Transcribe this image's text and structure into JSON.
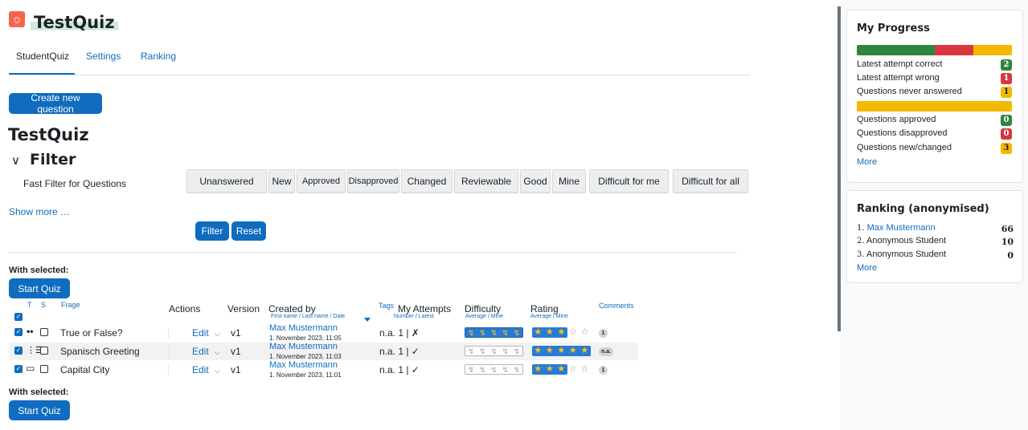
{
  "header": {
    "title": "TestQuiz"
  },
  "tabs": [
    {
      "label": "StudentQuiz"
    },
    {
      "label": "Settings"
    },
    {
      "label": "Ranking"
    }
  ],
  "create_button": "Create new question",
  "main_heading": "TestQuiz",
  "filter": {
    "heading": "Filter",
    "fast_filter_label": "Fast Filter for Questions",
    "buttons": [
      "Unanswered",
      "New",
      "Approved",
      "Disapproved",
      "Changed",
      "Reviewable",
      "Good",
      "Mine",
      "Difficult for me",
      "Difficult for all"
    ],
    "show_more": "Show more …",
    "filter_button": "Filter",
    "reset_button": "Reset"
  },
  "with_selected_label": "With selected:",
  "start_quiz_button": "Start Quiz",
  "table": {
    "headers": {
      "t": "T",
      "s": "S",
      "frage": "Frage",
      "actions": "Actions",
      "version": "Version",
      "created_by": "Created by",
      "created_by_sub": "First name / Last name / Date",
      "tags": "Tags",
      "my_attempts": "My Attempts",
      "my_attempts_sub": "Number / Latest",
      "difficulty": "Difficulty",
      "difficulty_sub": "Average / Mine",
      "rating": "Rating",
      "rating_sub": "Average / Mine",
      "comments": "Comments"
    },
    "rows": [
      {
        "question": "True or False?",
        "action": "Edit",
        "version": "v1",
        "creator": "Max Mustermann",
        "date": "1. November 2023, 11:05",
        "attempts": "n.a.  1 | ✗",
        "difficulty_level": 5,
        "rating": 3,
        "comments": "1"
      },
      {
        "question": "Spanisch Greeting",
        "action": "Edit",
        "version": "v1",
        "creator": "Max Mustermann",
        "date": "1. November 2023, 11:03",
        "attempts": "n.a.  1 | ✓",
        "difficulty_level": 0,
        "rating": 5,
        "comments": "n.a."
      },
      {
        "question": "Capital City",
        "action": "Edit",
        "version": "v1",
        "creator": "Max Mustermann",
        "date": "1. November 2023, 11:01",
        "attempts": "n.a.  1 | ✓",
        "difficulty_level": 0,
        "rating": 3,
        "comments": "1"
      }
    ]
  },
  "progress": {
    "title": "My Progress",
    "bar1": {
      "correct": 2,
      "wrong": 1,
      "never": 1
    },
    "bar2": {
      "approved": 0,
      "disapproved": 0,
      "new": 3
    },
    "rows": [
      {
        "label": "Latest attempt correct",
        "value": "2",
        "color": "#2e8540"
      },
      {
        "label": "Latest attempt wrong",
        "value": "1",
        "color": "#d9363e"
      },
      {
        "label": "Questions never answered",
        "value": "1",
        "color": "#f5b800"
      },
      {
        "label": "Questions approved",
        "value": "0",
        "color": "#2e8540"
      },
      {
        "label": "Questions disapproved",
        "value": "0",
        "color": "#d9363e"
      },
      {
        "label": "Questions new/changed",
        "value": "3",
        "color": "#f5b800"
      }
    ],
    "more": "More"
  },
  "ranking": {
    "title": "Ranking (anonymised)",
    "rows": [
      {
        "rank": "1.",
        "name": "Max Mustermann",
        "points": "66"
      },
      {
        "rank": "2.",
        "name": "Anonymous Student",
        "points": "10"
      },
      {
        "rank": "3.",
        "name": "Anonymous Student",
        "points": "0"
      }
    ],
    "more": "More"
  },
  "colors": {
    "primary": "#0f6cbf",
    "green": "#2e8540",
    "red": "#d9363e",
    "yellow": "#f5b800"
  }
}
